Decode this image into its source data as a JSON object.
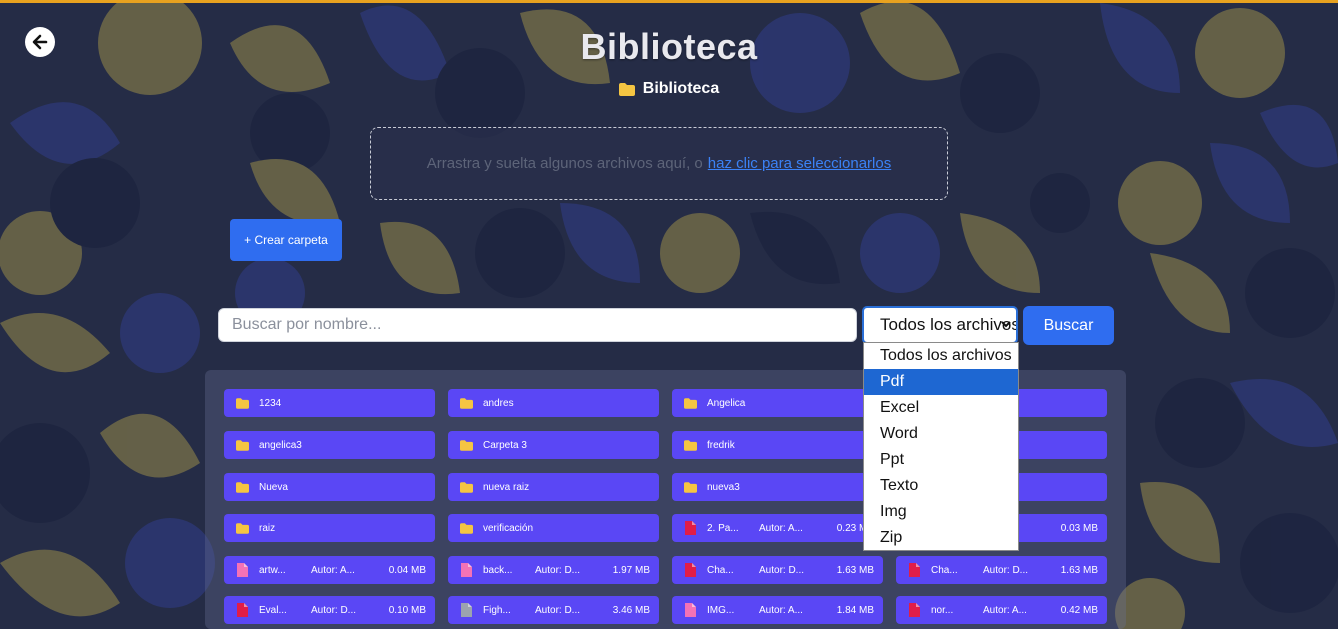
{
  "page": {
    "title": "Biblioteca"
  },
  "breadcrumb": {
    "label": "Biblioteca",
    "icon": "folder-icon"
  },
  "dropzone": {
    "text": "Arrastra y suelta algunos archivos aquí, o",
    "link": "haz clic para seleccionarlos"
  },
  "create_folder_button": "+ Crear carpeta",
  "search": {
    "placeholder": "Buscar por nombre...",
    "value": ""
  },
  "filter": {
    "selected": "Todos los archivos",
    "options": [
      "Todos los archivos",
      "Pdf",
      "Excel",
      "Word",
      "Ppt",
      "Texto",
      "Img",
      "Zip"
    ],
    "highlighted": "Pdf"
  },
  "search_button": "Buscar",
  "colors": {
    "accent_bar": "#e8a21f",
    "button": "#2f6df0",
    "item_bg": "#5a47f5",
    "folder": "#f5c542",
    "pdf": "#e11d48",
    "image": "#f472b6",
    "file": "#9ca3af"
  },
  "folders": [
    {
      "name": "1234"
    },
    {
      "name": "andres"
    },
    {
      "name": "Angelica"
    },
    {
      "name": "angelica3"
    },
    {
      "name": "Carpeta 3"
    },
    {
      "name": "fredrik"
    },
    {
      "name": "Nueva"
    },
    {
      "name": "nueva raiz"
    },
    {
      "name": "nueva3"
    },
    {
      "name": "raiz"
    },
    {
      "name": "verificación"
    }
  ],
  "files": [
    {
      "name": "2. Pa...",
      "autor": "Autor: A...",
      "size": "0.23 MB",
      "type": "pdf"
    },
    {
      "name": "",
      "autor": "",
      "size": "0.03 MB",
      "type": "pdf"
    },
    {
      "name": "artw...",
      "autor": "Autor: A...",
      "size": "0.04 MB",
      "type": "image"
    },
    {
      "name": "back...",
      "autor": "Autor: D...",
      "size": "1.97 MB",
      "type": "image"
    },
    {
      "name": "Cha...",
      "autor": "Autor: D...",
      "size": "1.63 MB",
      "type": "pdf"
    },
    {
      "name": "Cha...",
      "autor": "Autor: D...",
      "size": "1.63 MB",
      "type": "pdf"
    },
    {
      "name": "Eval...",
      "autor": "Autor: D...",
      "size": "0.10 MB",
      "type": "pdf"
    },
    {
      "name": "Figh...",
      "autor": "Autor: D...",
      "size": "3.46 MB",
      "type": "file"
    },
    {
      "name": "IMG...",
      "autor": "Autor: A...",
      "size": "1.84 MB",
      "type": "image"
    },
    {
      "name": "nor...",
      "autor": "Autor: A...",
      "size": "0.42 MB",
      "type": "pdf"
    }
  ]
}
